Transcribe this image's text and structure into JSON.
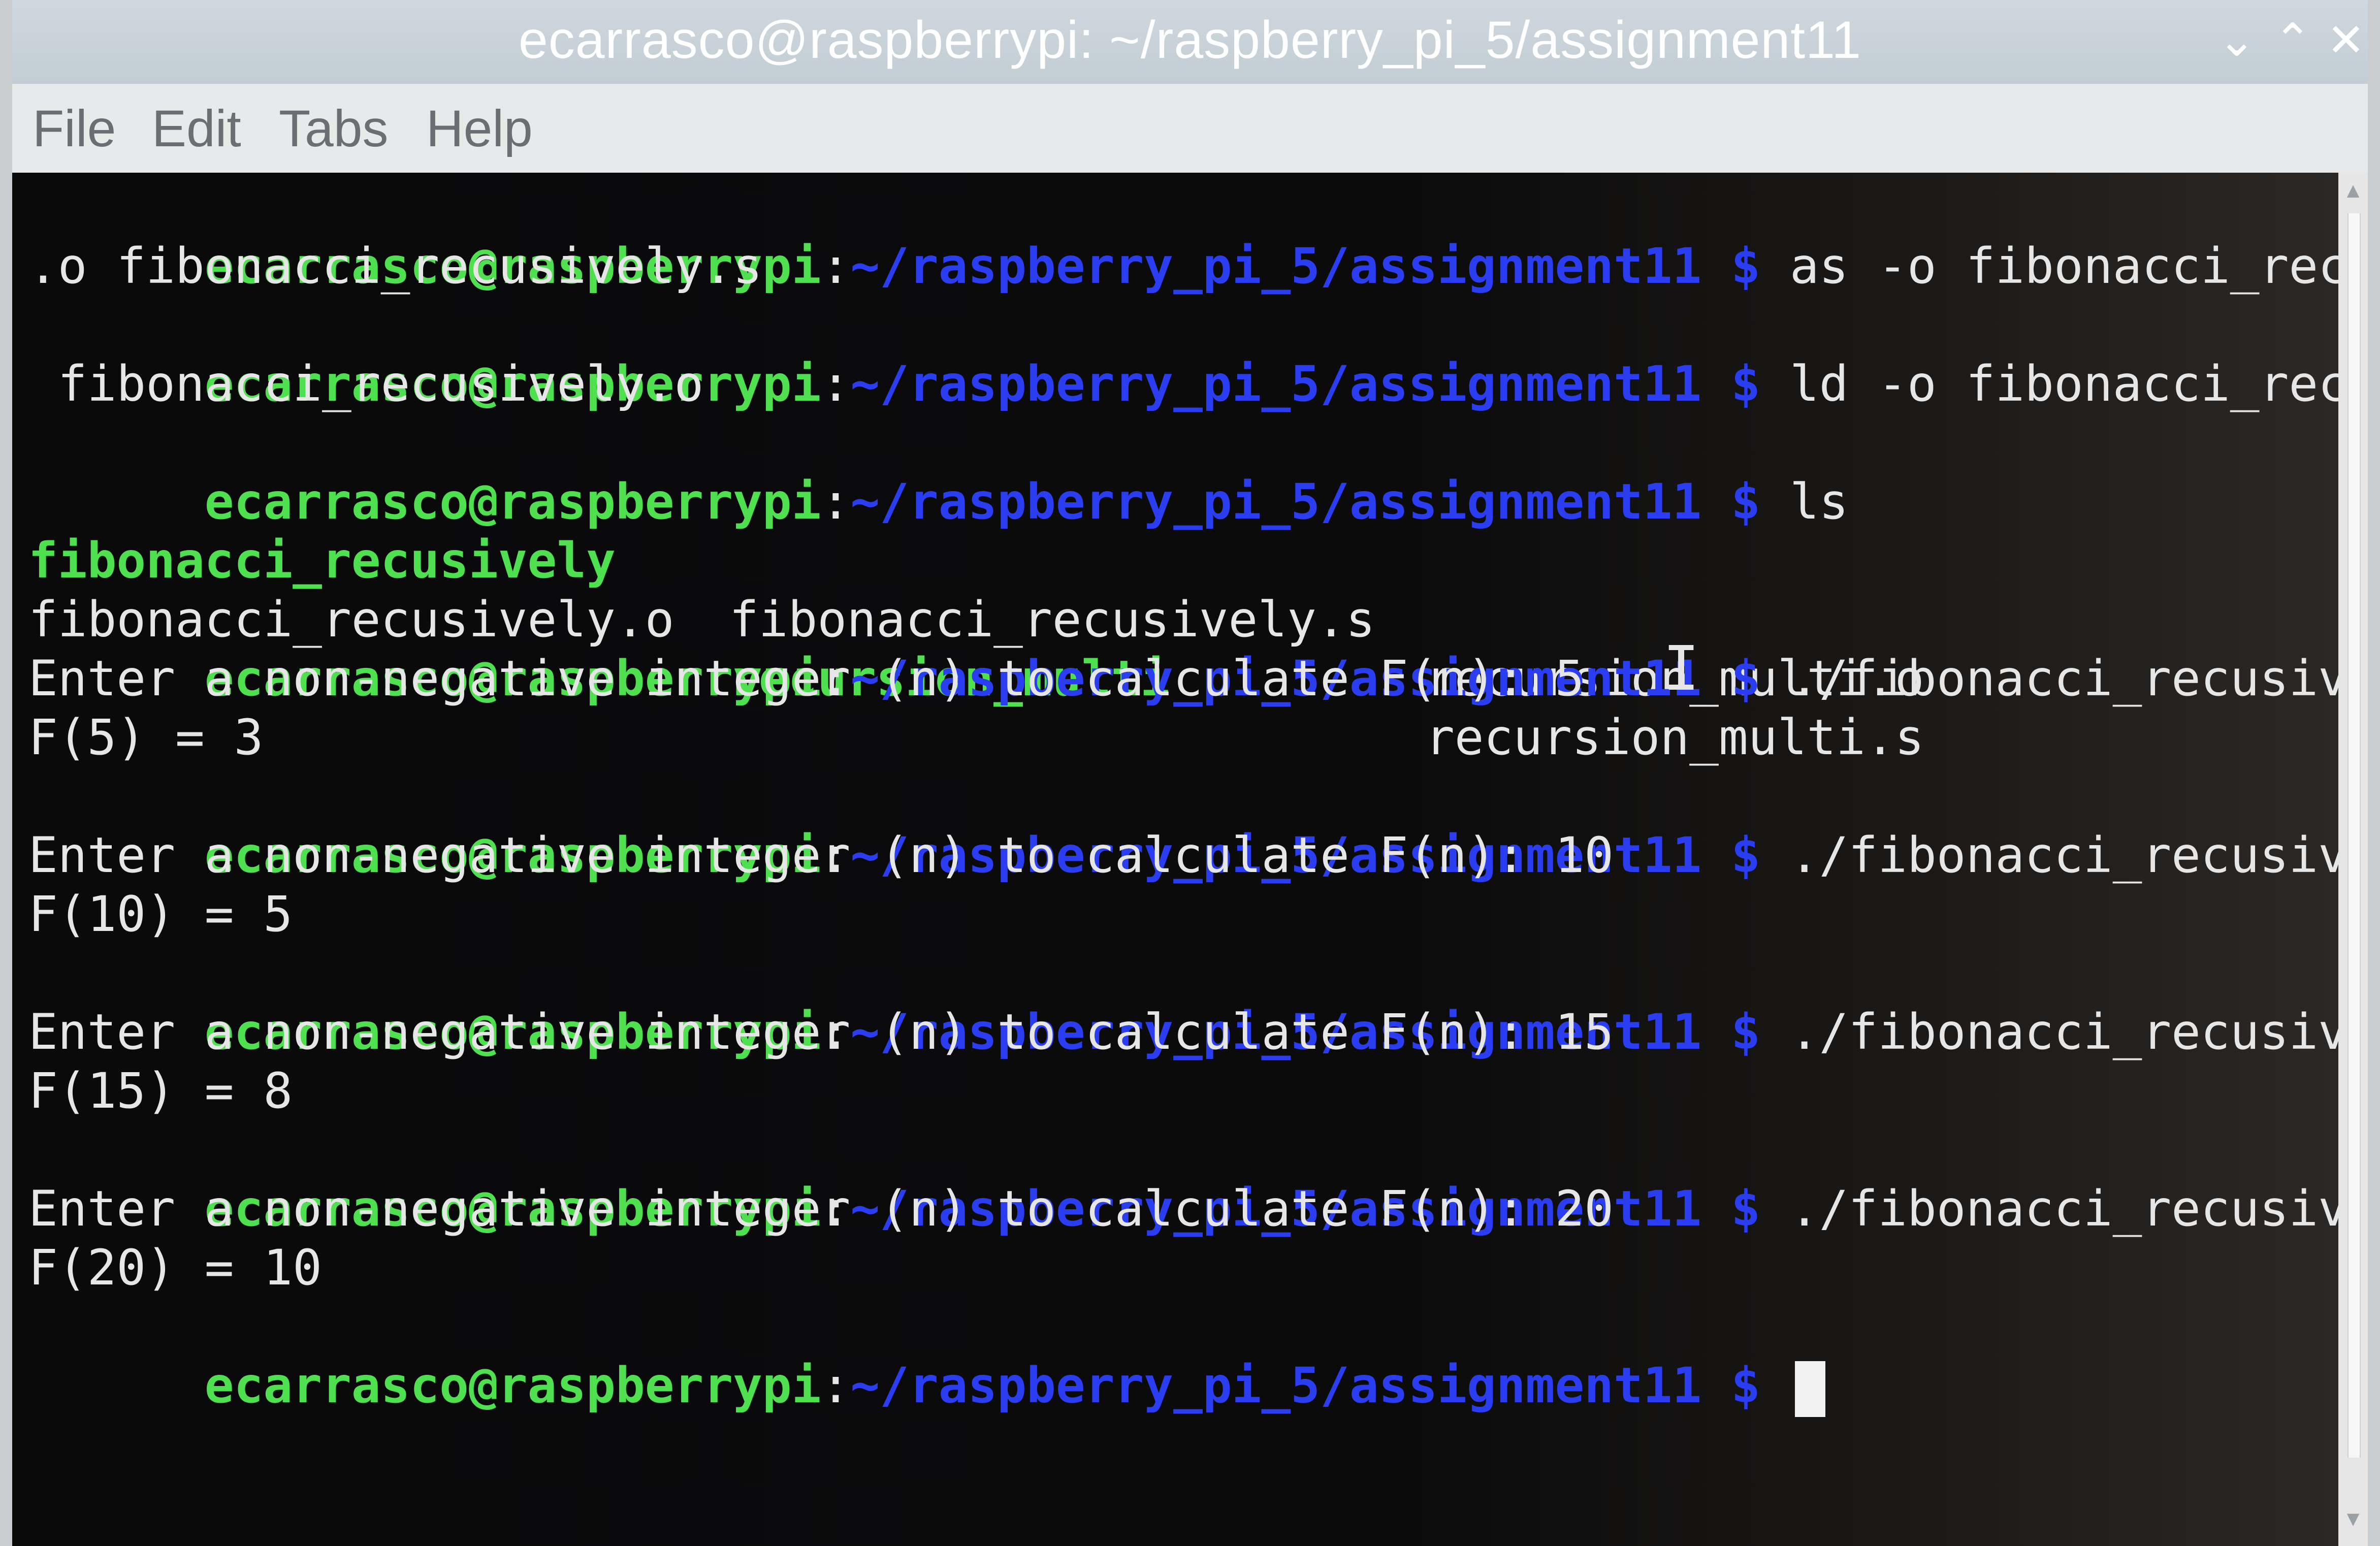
{
  "window": {
    "title": "ecarrasco@raspberrypi: ~/raspberry_pi_5/assignment11",
    "controls": {
      "minimize": "⌄",
      "maximize": "⌃",
      "close": "✕"
    }
  },
  "menu": [
    "File",
    "Edit",
    "Tabs",
    "Help"
  ],
  "prompt": {
    "user": "ecarrasco@raspberrypi",
    "colon": ":",
    "path": "~/raspberry_pi_5/assignment11",
    "dollar": " $ "
  },
  "lines": {
    "cmd1": "as -o fibonacci_recusively",
    "cmd1_wrap": ".o fibonacci_recusively.s",
    "cmd2": "ld -o fibonacci_recusively",
    "cmd2_wrap": " fibonacci_recusively.o",
    "cmd3": "ls",
    "ls": {
      "r1c1": "fibonacci_recusively",
      "r1c2": "fibonacci_recusively.s",
      "r1c3": "recursion_multi.o",
      "r2c1": "fibonacci_recusively.o",
      "r2c2": "recursion_multi",
      "r2c3": "recursion_multi.s"
    },
    "run": "./fibonacci_recusively",
    "runs": [
      {
        "prompt": "Enter a non-negative integer (n) to calculate F(n): 5",
        "result": "F(5) = 3"
      },
      {
        "prompt": "Enter a non-negative integer (n) to calculate F(n): 10",
        "result": "F(10) = 5"
      },
      {
        "prompt": "Enter a non-negative integer (n) to calculate F(n): 15",
        "result": "F(15) = 8"
      },
      {
        "prompt": "Enter a non-negative integer (n) to calculate F(n): 20",
        "result": "F(20) = 10"
      }
    ]
  },
  "scrollbar": {
    "up": "▲",
    "down": "▼"
  },
  "colors": {
    "user": "#4fe04f",
    "path": "#2a3df0",
    "text": "#e6e6e6",
    "background": "#0b0b0c"
  }
}
